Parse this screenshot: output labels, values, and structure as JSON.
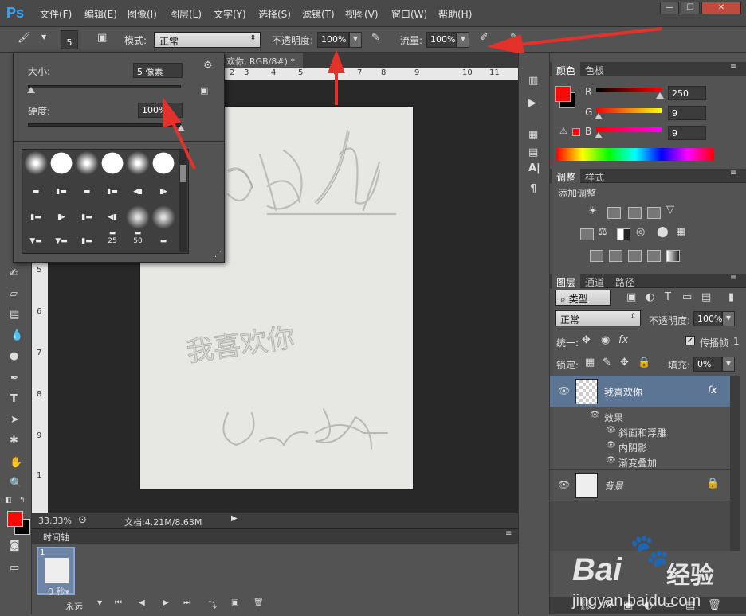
{
  "app": {
    "logo": "Ps"
  },
  "menu": [
    "文件(F)",
    "编辑(E)",
    "图像(I)",
    "图层(L)",
    "文字(Y)",
    "选择(S)",
    "滤镜(T)",
    "视图(V)",
    "窗口(W)",
    "帮助(H)"
  ],
  "window_controls": [
    "—",
    "☐",
    "✕"
  ],
  "options": {
    "brush_size": "5",
    "mode_label": "模式:",
    "mode_value": "正常",
    "opacity_label": "不透明度:",
    "opacity_value": "100%",
    "flow_label": "流量:",
    "flow_value": "100%"
  },
  "brush_panel": {
    "size_label": "大小:",
    "size_value": "5 像素",
    "hardness_label": "硬度:",
    "hardness_value": "100%",
    "hardness_level": 1.0,
    "size_level": 0.02,
    "preset_labels": [
      "25",
      "50"
    ]
  },
  "document": {
    "tab_title": "欢你, RGB/8#) *",
    "tab_close": "×",
    "ruler_h": [
      "2",
      "3",
      "4",
      "5",
      "6",
      "7",
      "8",
      "9",
      "10",
      "11"
    ],
    "ruler_v": [
      "5",
      "6",
      "7",
      "8",
      "9",
      "1"
    ],
    "canvas_texts": [
      "我喜欢你"
    ],
    "zoom": "33.33%",
    "doc_info": "文档:4.21M/8.63M"
  },
  "timeline": {
    "title": "时间轴",
    "frame_number": "1",
    "frame_delay": "0 秒▾",
    "loop": "永远"
  },
  "color_panel": {
    "tabs": [
      "颜色",
      "色板"
    ],
    "r_label": "R",
    "r_value": "250",
    "g_label": "G",
    "g_value": "9",
    "b_label": "B",
    "b_value": "9",
    "r_level": 0.98,
    "g_level": 0.035,
    "b_level": 0.035,
    "foreground": "#fa0909",
    "background": "#000000"
  },
  "adjustments": {
    "tabs": [
      "调整",
      "样式"
    ],
    "title": "添加调整"
  },
  "layers_panel": {
    "tabs": [
      "图层",
      "通道",
      "路径"
    ],
    "filter_kind": "类型",
    "blend_mode": "正常",
    "opacity_label": "不透明度:",
    "opacity_value": "100%",
    "unify_label": "统一:",
    "propagate_label": "传播帧",
    "propagate_value": "1",
    "lock_label": "锁定:",
    "fill_label": "填充:",
    "fill_value": "0%",
    "layers": [
      {
        "name": "我喜欢你",
        "fx": "fx"
      },
      {
        "name": "背景"
      }
    ],
    "effects_label": "效果",
    "effects": [
      "斜面和浮雕",
      "内阴影",
      "渐变叠加"
    ]
  },
  "watermark": {
    "brand": "Bai",
    "brand_tail": "经验",
    "url": "jingyan.baidu.com"
  }
}
